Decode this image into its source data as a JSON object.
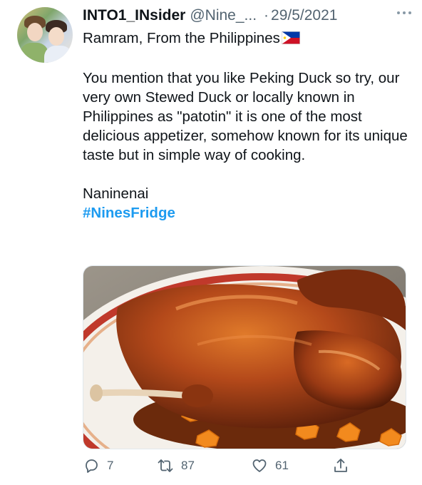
{
  "tweet": {
    "author_name": "INTO1_INsider",
    "handle": "@Nine_...",
    "separator": "·",
    "date": "29/5/2021",
    "more_icon": "more-dots-icon",
    "lines": [
      "Ramram, From the Philippines",
      "You mention that you like Peking Duck so try, our very own Stewed Duck or locally known in Philippines as \"patotin\"  it is one of the most delicious appetizer, somehow known for its unique taste but in simple way of cooking.",
      "Naninenai"
    ],
    "hashtag": "#NinesFridge",
    "flag_icon": "philippines-flag-icon",
    "media_description_icon": "duck-photo"
  },
  "actions": {
    "reply_count": "7",
    "retweet_count": "87",
    "like_count": "61"
  },
  "colors": {
    "link": "#1d9bf0",
    "secondary_text": "#536471",
    "primary_text": "#0f1419"
  }
}
